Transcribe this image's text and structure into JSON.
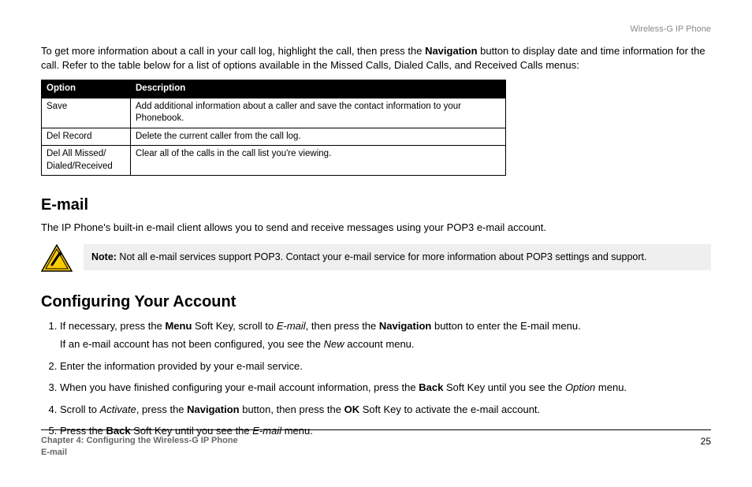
{
  "header": {
    "product": "Wireless-G IP Phone"
  },
  "intro": {
    "line1_a": "To get more information about a call in your call log, highlight the call, then press the ",
    "line1_bold": "Navigation",
    "line1_b": " button to display date and time information for the call. Refer to the table below for a list of options available in the Missed Calls, Dialed Calls, and Received Calls menus:"
  },
  "table": {
    "headers": {
      "option": "Option",
      "description": "Description"
    },
    "rows": [
      {
        "option": "Save",
        "desc": "Add additional information about a caller and save the contact information to your Phonebook."
      },
      {
        "option": "Del Record",
        "desc": "Delete the current caller from the call log."
      },
      {
        "option": "Del All Missed/ Dialed/Received",
        "desc": "Clear all of the calls in the call list you're viewing."
      }
    ]
  },
  "email": {
    "heading": "E-mail",
    "body": "The IP Phone's built-in e-mail client allows you to send and receive messages using your POP3 e-mail account.",
    "note_label": "Note:",
    "note_text": " Not all e-mail services support POP3. Contact your e-mail service for more information about POP3 settings and support."
  },
  "config": {
    "heading": "Configuring Your Account",
    "s1_a": "If necessary, press the ",
    "s1_b1": "Menu",
    "s1_b": " Soft Key, scroll to ",
    "s1_i1": "E-mail",
    "s1_c": ", then press the ",
    "s1_b2": "Navigation",
    "s1_d": " button to enter the E-mail menu.",
    "s1_sub_a": "If an e-mail account has not been configured, you see the ",
    "s1_sub_i": "New",
    "s1_sub_b": " account menu.",
    "s2": "Enter the information provided by your e-mail service.",
    "s3_a": "When you have finished configuring your e-mail account information, press the ",
    "s3_b1": "Back",
    "s3_b": " Soft Key until you see the ",
    "s3_i1": "Option",
    "s3_c": " menu.",
    "s4_a": "Scroll to ",
    "s4_i1": "Activate",
    "s4_b": ", press the ",
    "s4_b1": "Navigation",
    "s4_c": " button, then press the ",
    "s4_b2": "OK",
    "s4_d": " Soft Key to activate the e-mail account.",
    "s5_a": "Press the ",
    "s5_b1": "Back",
    "s5_b": " Soft Key until you see the ",
    "s5_i1": "E-mail",
    "s5_c": " menu."
  },
  "footer": {
    "chapter": "Chapter 4: Configuring the Wireless-G IP Phone",
    "section": "E-mail",
    "page": "25"
  }
}
